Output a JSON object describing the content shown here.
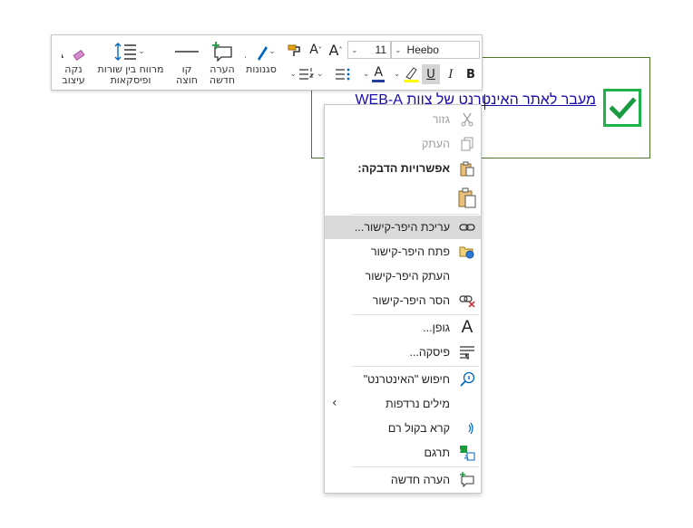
{
  "document": {
    "link_text": "מעבר לאתר האינטרנט של צוות WEB-A"
  },
  "toolbar": {
    "font_name": "Heebo",
    "font_size": "11",
    "clear_format_label_1": "נקה",
    "clear_format_label_2": "עיצוב",
    "line_spacing_label_1": "מרווח בין שורות",
    "line_spacing_label_2": "ופיסקאות",
    "strike_label_1": "קו",
    "strike_label_2": "חוצה",
    "new_comment_label_1": "הערה",
    "new_comment_label_2": "חדשה",
    "styles_label": "סגנונות",
    "bold_glyph": "B",
    "italic_glyph": "I",
    "underline_glyph": "U",
    "font_color_glyph": "A",
    "grow_font_glyph": "A",
    "shrink_font_glyph": "A",
    "colors": {
      "highlight": "#ffff00",
      "font_color": "#1f3f99",
      "accent": "#0067c0"
    }
  },
  "context_menu": {
    "items": [
      {
        "label": "גזור",
        "icon": "cut-icon",
        "disabled": true
      },
      {
        "label": "העתק",
        "icon": "copy-icon",
        "disabled": true
      },
      {
        "label": "אפשרויות הדבקה:",
        "icon": "paste-icon",
        "header": true
      },
      {
        "label": "",
        "icon": "paste-keep-text-icon"
      },
      {
        "label": "עריכת היפר-קישור...",
        "icon": "edit-link-icon",
        "highlighted": true
      },
      {
        "label": "פתח היפר-קישור",
        "icon": "open-link-icon"
      },
      {
        "label": "העתק היפר-קישור",
        "icon": ""
      },
      {
        "label": "הסר היפר-קישור",
        "icon": "remove-link-icon"
      },
      {
        "label": "גופן...",
        "icon": "font-icon"
      },
      {
        "label": "פיסקה...",
        "icon": "paragraph-icon"
      },
      {
        "label": "חיפוש \"האינטרנט\"",
        "icon": "search-icon"
      },
      {
        "label": "מילים נרדפות",
        "icon": "",
        "submenu": true
      },
      {
        "label": "קרא בקול רם",
        "icon": "read-aloud-icon"
      },
      {
        "label": "תרגם",
        "icon": "translate-icon"
      },
      {
        "label": "הערה חדשה",
        "icon": "new-comment-icon"
      }
    ]
  }
}
